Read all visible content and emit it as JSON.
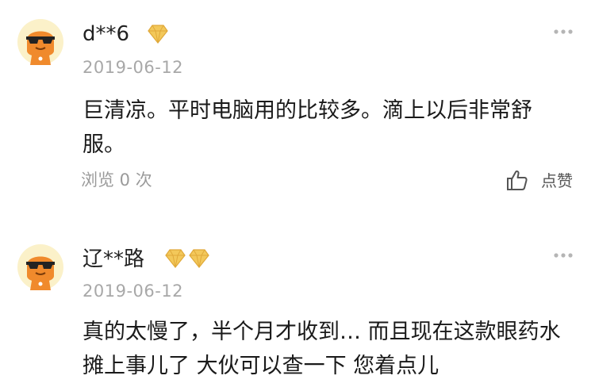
{
  "reviews": [
    {
      "username": "d**6",
      "badge_count": 1,
      "date": "2019-06-12",
      "content": "巨清凉。平时电脑用的比较多。滴上以后非常舒服。",
      "views": "浏览 0 次",
      "like_label": "点赞"
    },
    {
      "username": "辽**路",
      "badge_count": 2,
      "date": "2019-06-12",
      "content": "真的太慢了，半个月才收到… 而且现在这款眼药水摊上事儿了 大伙可以查一下 您着点儿"
    }
  ],
  "colors": {
    "avatar_bg": "#fbf1c9",
    "avatar_orange": "#f08a2c",
    "badge_gold": "#f3c85a",
    "text_muted": "#a8a8a8"
  },
  "icons": {
    "avatar": "sunglasses-avatar-icon",
    "badge": "diamond-badge-icon",
    "more": "more-dots-icon",
    "like": "thumbs-up-icon"
  }
}
